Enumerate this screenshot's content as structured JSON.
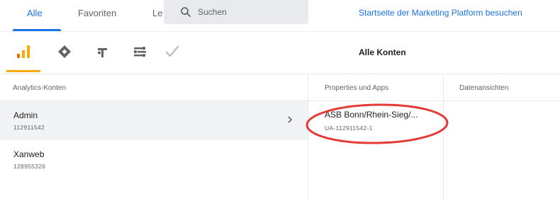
{
  "tabs": [
    {
      "label": "Alle",
      "active": true
    },
    {
      "label": "Favoriten",
      "active": false
    },
    {
      "label": "Le",
      "active": false
    }
  ],
  "search": {
    "placeholder": "Suchen"
  },
  "marketing_link": "Startseite der Marketing Platform besuchen",
  "products": [
    {
      "icon": "analytics-icon",
      "active": true
    },
    {
      "icon": "tag-manager-icon"
    },
    {
      "icon": "optimize-icon"
    },
    {
      "icon": "data-studio-icon"
    },
    {
      "icon": "surveys-check-icon"
    }
  ],
  "scope_title": "Alle Konten",
  "columns": {
    "accounts": "Analytics-Konten",
    "properties": "Properties und Apps",
    "views": "Datenansichten"
  },
  "accounts": [
    {
      "name": "Admin",
      "id": "112911542",
      "selected": true
    },
    {
      "name": "Xanweb",
      "id": "128955326",
      "selected": false
    }
  ],
  "properties": [
    {
      "name": "ASB Bonn/Rhein-Sieg/...",
      "id": "UA-112911542-1"
    }
  ],
  "colors": {
    "accent": "#1a73e8",
    "analytics": "#f9ab00",
    "highlight": "#e53935",
    "selected_row": "#f1f3f4"
  }
}
